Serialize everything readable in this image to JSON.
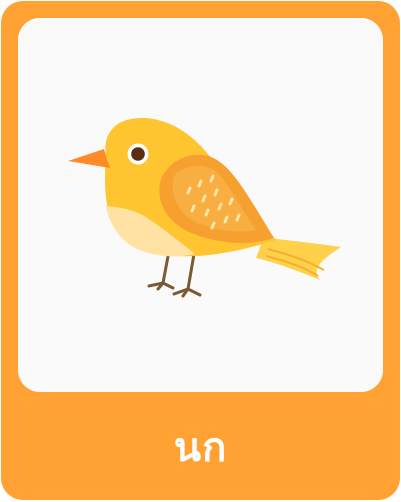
{
  "card": {
    "word": "นก",
    "illustration_icon": "bird-icon",
    "colors": {
      "frame": "#FFA233",
      "panel": "#FAFAFA",
      "label_text": "#FFFFFF",
      "bird_body": "#FFC531",
      "bird_belly": "#FFE2A4",
      "bird_wing": "#F6A12F",
      "bird_beak": "#FF8A28",
      "bird_legs": "#7A5A33"
    }
  }
}
